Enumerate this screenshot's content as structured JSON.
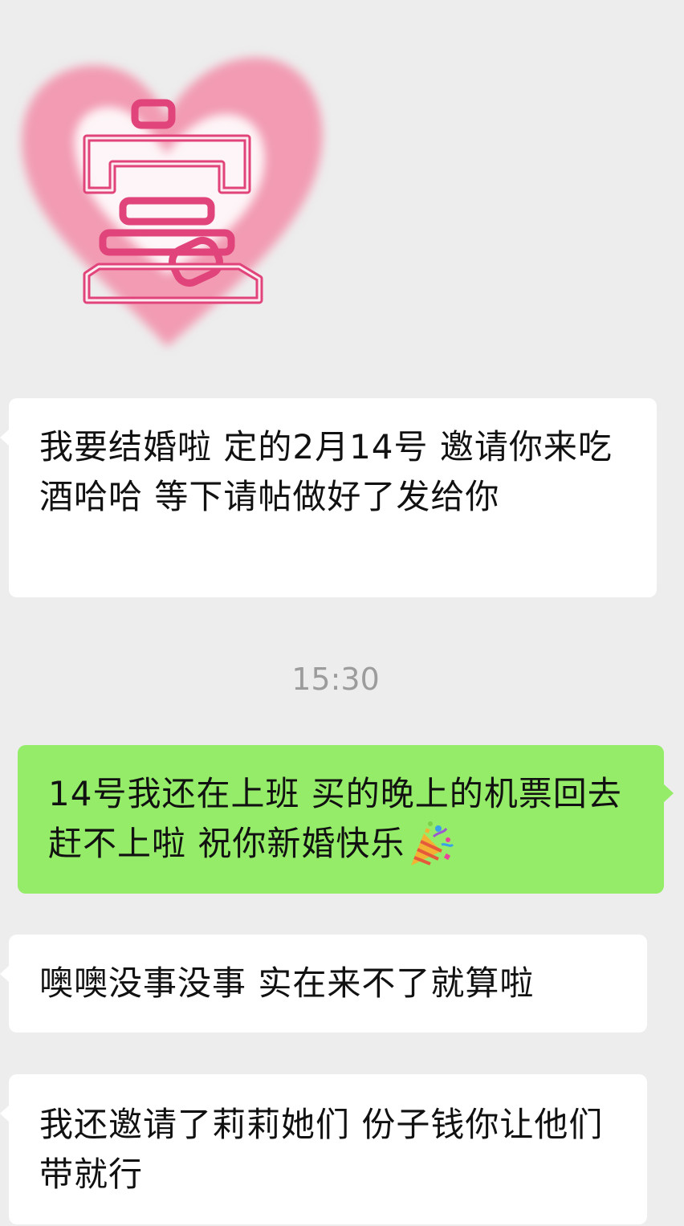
{
  "sticker": {
    "icon": "heart-bao-sticker",
    "character": "宝",
    "heart_color": "#f29bb3",
    "outline_color": "#e0447a"
  },
  "messages": [
    {
      "side": "left",
      "text": "我要结婚啦 定的2月14号 邀请你来吃酒哈哈 等下请帖做好了发给你"
    },
    {
      "side": "right",
      "text": "14号我还在上班 买的晚上的机票回去 赶不上啦 祝你新婚快乐",
      "emoji": "party-popper-icon"
    },
    {
      "side": "left",
      "text": "噢噢没事没事 实在来不了就算啦"
    },
    {
      "side": "left",
      "text": "我还邀请了莉莉她们 份子钱你让他们带就行"
    }
  ],
  "timestamp": "15:30",
  "colors": {
    "background": "#ededed",
    "incoming_bubble": "#ffffff",
    "outgoing_bubble": "#95ec69",
    "timestamp_text": "#9c9c9c"
  }
}
